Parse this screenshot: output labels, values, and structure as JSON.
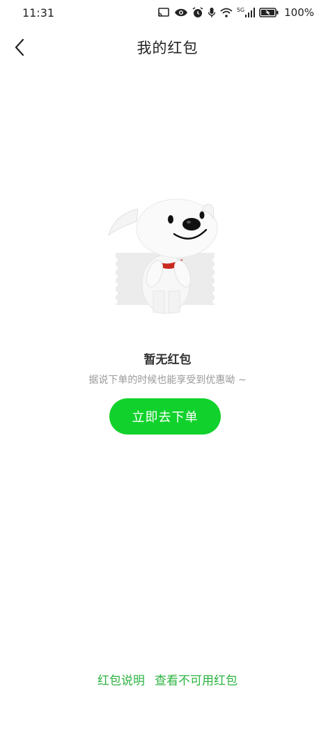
{
  "status_bar": {
    "time": "11:31",
    "battery_percent": "100%",
    "network_label": "5G",
    "icons": [
      "cast-icon",
      "eye-icon",
      "alarm-icon",
      "mic-icon",
      "wifi-icon",
      "signal-icon",
      "battery-icon"
    ]
  },
  "header": {
    "title": "我的红包",
    "back_icon": "chevron-left-icon"
  },
  "empty_state": {
    "illustration": "jd-dog-mascot-with-coupon",
    "title": "暂无红包",
    "subtitle": "据说下单的时候也能享受到优惠呦 ~",
    "button_label": "立即去下单"
  },
  "footer": {
    "links": [
      "红包说明",
      "查看不可用红包"
    ]
  },
  "colors": {
    "accent_green": "#11d22c",
    "link_green": "#2bb33f"
  }
}
